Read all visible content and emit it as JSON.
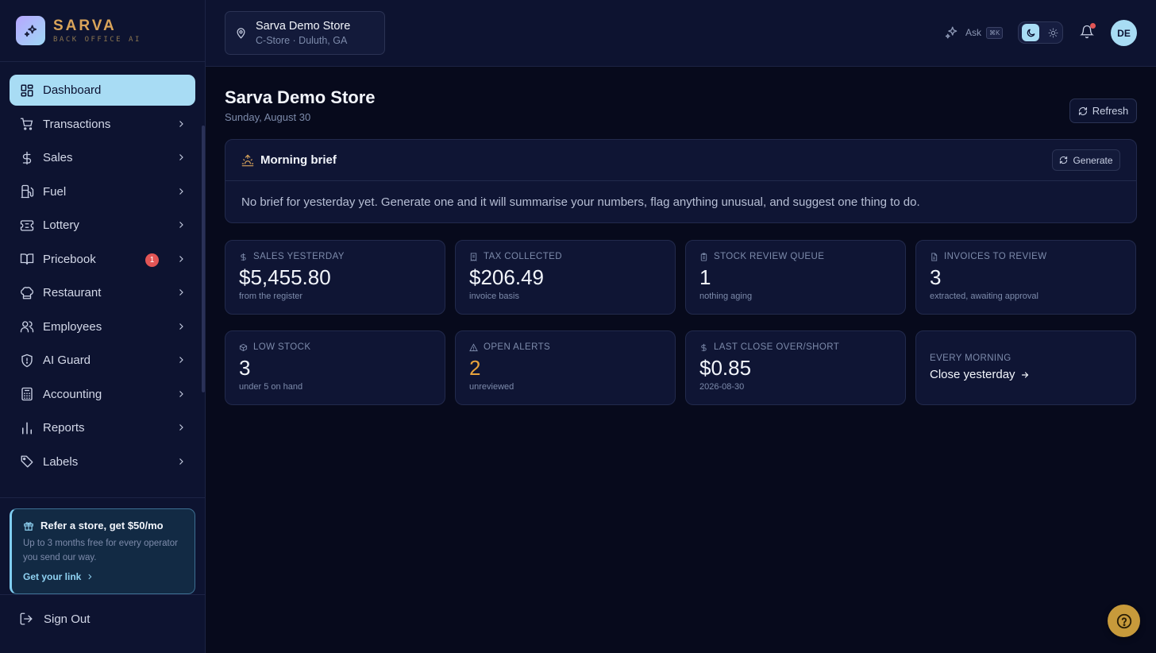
{
  "brand": {
    "name": "SARVA",
    "tagline": "BACK OFFICE AI"
  },
  "sidebar": {
    "items": [
      {
        "label": "Dashboard",
        "icon": "dashboard-icon",
        "active": true
      },
      {
        "label": "Transactions",
        "icon": "cart-icon"
      },
      {
        "label": "Sales",
        "icon": "dollar-icon"
      },
      {
        "label": "Fuel",
        "icon": "fuel-icon"
      },
      {
        "label": "Lottery",
        "icon": "ticket-icon"
      },
      {
        "label": "Pricebook",
        "icon": "book-icon",
        "badge": "1"
      },
      {
        "label": "Restaurant",
        "icon": "chef-hat-icon"
      },
      {
        "label": "Employees",
        "icon": "users-icon"
      },
      {
        "label": "AI Guard",
        "icon": "shield-icon"
      },
      {
        "label": "Accounting",
        "icon": "calculator-icon"
      },
      {
        "label": "Reports",
        "icon": "bar-chart-icon"
      },
      {
        "label": "Labels",
        "icon": "tag-icon"
      }
    ],
    "refer": {
      "title": "Refer a store, get $50/mo",
      "desc": "Up to 3 months free for every operator you send our way.",
      "link": "Get your link"
    },
    "signout": "Sign Out"
  },
  "topbar": {
    "store_name": "Sarva Demo Store",
    "store_location": "C-Store · Duluth, GA",
    "ask_label": "Ask",
    "ask_shortcut": "⌘K",
    "avatar_initials": "DE"
  },
  "main": {
    "title": "Sarva Demo Store",
    "date": "Sunday, August 30",
    "refresh_label": "Refresh",
    "brief": {
      "title": "Morning brief",
      "generate_label": "Generate",
      "body": "No brief for yesterday yet. Generate one and it will summarise your numbers, flag anything unusual, and suggest one thing to do."
    },
    "cards": [
      {
        "label": "Sales yesterday",
        "icon": "dollar-icon",
        "value": "$5,455.80",
        "sub": "from the register"
      },
      {
        "label": "Tax collected",
        "icon": "receipt-icon",
        "value": "$206.49",
        "sub": "invoice basis"
      },
      {
        "label": "Stock review queue",
        "icon": "clipboard-icon",
        "value": "1",
        "sub": "nothing aging"
      },
      {
        "label": "Invoices to review",
        "icon": "document-icon",
        "value": "3",
        "sub": "extracted, awaiting approval"
      },
      {
        "label": "Low stock",
        "icon": "box-icon",
        "value": "3",
        "sub": "under 5 on hand"
      },
      {
        "label": "Open alerts",
        "icon": "warning-icon",
        "value": "2",
        "sub": "unreviewed"
      },
      {
        "label": "Last close over/short",
        "icon": "dollar-icon",
        "value": "$0.85",
        "sub": "2026-08-30"
      }
    ],
    "close_card": {
      "eyebrow": "EVERY MORNING",
      "cta": "Close yesterday"
    }
  },
  "colors": {
    "accent": "#a8dcf4",
    "brand": "#d9a45a",
    "warning": "#e8a33c",
    "badge": "#e25555"
  }
}
